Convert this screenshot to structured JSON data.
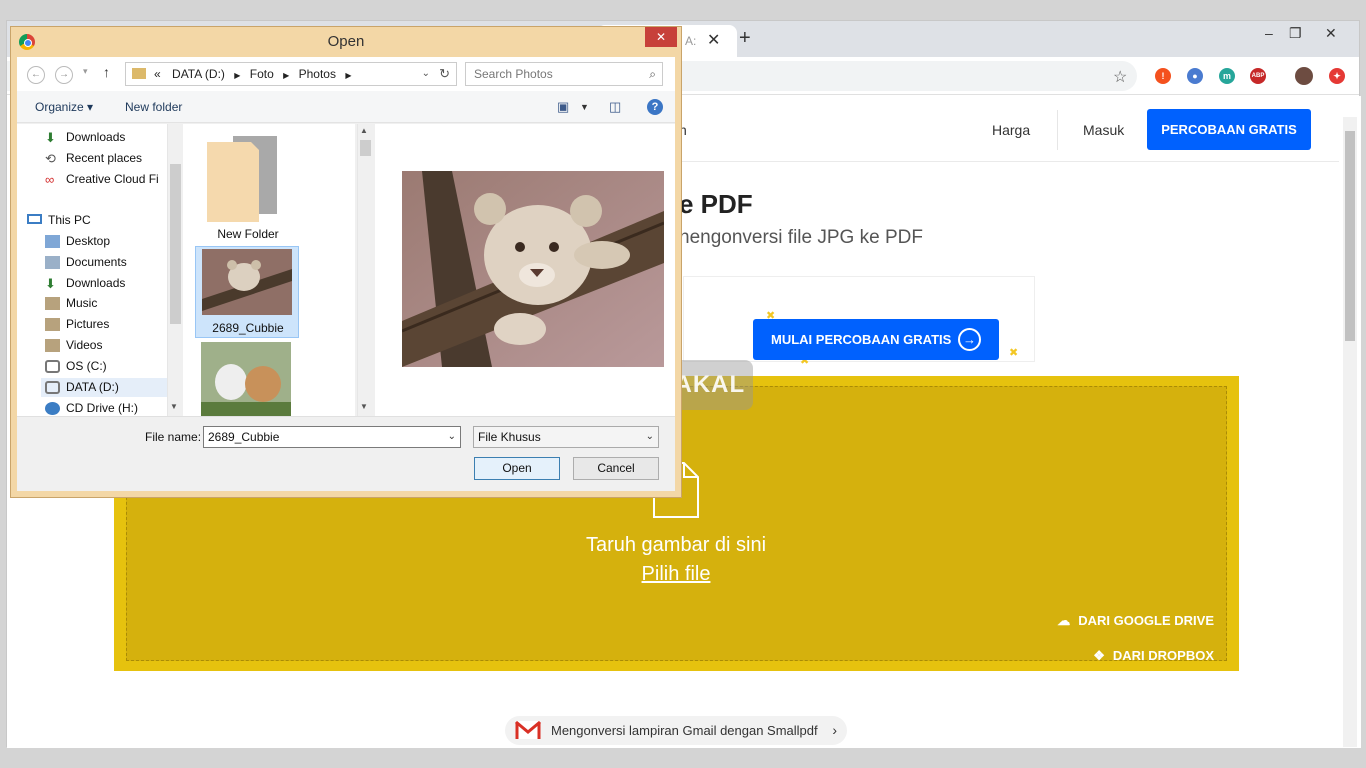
{
  "browser": {
    "tab_title_fragment": "A:",
    "tab_close": "✕",
    "new_tab": "+",
    "minimize": "–",
    "restore": "❐",
    "close": "✕",
    "extensions": [
      {
        "name": "alert",
        "glyph": "!",
        "color": "#f4511e"
      },
      {
        "name": "person",
        "glyph": "●",
        "color": "#4a7bd0"
      },
      {
        "name": "m",
        "glyph": "m",
        "color": "#26a69a"
      },
      {
        "name": "abp",
        "glyph": "ABP",
        "color": "#c62828"
      },
      {
        "name": "avatar",
        "glyph": "",
        "color": "#6d4c41"
      },
      {
        "name": "red",
        "glyph": "✦",
        "color": "#e53935"
      }
    ]
  },
  "page": {
    "nav": {
      "partial": "n",
      "harga": "Harga",
      "masuk": "Masuk",
      "trial": "PERCOBAAN GRATIS"
    },
    "hero_title": "e PDF",
    "hero_subtitle": "nengonversi file JPG ke PDF",
    "start_button": "MULAI PERCOBAAN GRATIS",
    "drop": {
      "text": "Taruh gambar di sini",
      "link": "Pilih file",
      "google_drive": "DARI GOOGLE DRIVE",
      "dropbox": "DARI DROPBOX"
    },
    "gmail_pill": "Mengonversi lampiran Gmail dengan Smallpdf",
    "accent": "#0061fe",
    "drop_color": "#d5b10d"
  },
  "watermark": "BERAKAL",
  "dialog": {
    "title": "Open",
    "close": "✕",
    "path": [
      "«",
      "DATA (D:)",
      "Foto",
      "Photos"
    ],
    "search_placeholder": "Search Photos",
    "organize": "Organize ▾",
    "new_folder": "New folder",
    "nav_items": [
      {
        "label": "Downloads",
        "kind": "download"
      },
      {
        "label": "Recent places",
        "kind": "recent"
      },
      {
        "label": "Creative Cloud Fi",
        "kind": "cc"
      },
      {
        "label": "This PC",
        "kind": "pc"
      },
      {
        "label": "Desktop",
        "kind": "folder"
      },
      {
        "label": "Documents",
        "kind": "folder"
      },
      {
        "label": "Downloads",
        "kind": "download"
      },
      {
        "label": "Music",
        "kind": "folder"
      },
      {
        "label": "Pictures",
        "kind": "folder"
      },
      {
        "label": "Videos",
        "kind": "folder"
      },
      {
        "label": "OS (C:)",
        "kind": "drive"
      },
      {
        "label": "DATA (D:)",
        "kind": "drive"
      },
      {
        "label": "CD Drive (H:)",
        "kind": "cd"
      }
    ],
    "selected_nav": "DATA (D:)",
    "files": [
      {
        "label": "New Folder",
        "kind": "folder"
      },
      {
        "label": "2689_Cubbie",
        "kind": "image",
        "selected": true
      },
      {
        "label": "",
        "kind": "image"
      }
    ],
    "file_name_label": "File name:",
    "file_name_value": "2689_Cubbie",
    "file_type": "File Khusus",
    "open_button": "Open",
    "cancel_button": "Cancel"
  }
}
